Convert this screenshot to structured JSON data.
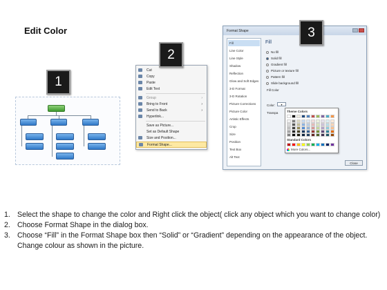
{
  "page": {
    "title": "Edit Color"
  },
  "badges": {
    "one": "1",
    "two": "2",
    "three": "3"
  },
  "context_menu": {
    "items": [
      {
        "label": "Cut",
        "arrow": false
      },
      {
        "label": "Copy",
        "arrow": false
      },
      {
        "label": "Paste",
        "arrow": false
      },
      {
        "label": "Edit Text",
        "arrow": false
      },
      {
        "label": "Group",
        "arrow": true
      },
      {
        "label": "Bring to Front",
        "arrow": true
      },
      {
        "label": "Send to Back",
        "arrow": true
      },
      {
        "label": "Hyperlink...",
        "arrow": false
      },
      {
        "label": "Save as Picture...",
        "arrow": false
      },
      {
        "label": "Set as Default Shape",
        "arrow": false
      },
      {
        "label": "Size and Position...",
        "arrow": false
      },
      {
        "label": "Format Shape...",
        "arrow": false
      }
    ],
    "selected_label": "Format Shape..."
  },
  "dialog": {
    "title": "Format Shape",
    "nav": [
      "Fill",
      "Line Color",
      "Line Style",
      "Shadow",
      "Reflection",
      "Glow and Soft Edges",
      "3-D Format",
      "3-D Rotation",
      "Picture Corrections",
      "Picture Color",
      "Artistic Effects",
      "Crop",
      "Size",
      "Position",
      "Text Box",
      "Alt Text"
    ],
    "selected_nav": "Fill",
    "section_title": "Fill",
    "options": [
      "No fill",
      "Solid fill",
      "Gradient fill",
      "Picture or texture fill",
      "Pattern fill",
      "Slide background fill"
    ],
    "selected_option": "Solid fill",
    "fill_color_label": "Fill Color",
    "color_label": "Color:",
    "transparency_label": "Transpa",
    "palette": {
      "theme_title": "Theme Colors",
      "standard_title": "Standard Colors",
      "more_label": "More Colors...",
      "theme_top": [
        "#ffffff",
        "#000000",
        "#eeece1",
        "#1f497d",
        "#4f81bd",
        "#c0504d",
        "#9bbb59",
        "#8064a2",
        "#4bacc6",
        "#f79646"
      ],
      "theme_shades": [
        [
          "#f2f2f2",
          "#7f7f7f",
          "#ddd9c3",
          "#c6d9f0",
          "#dbe5f1",
          "#f2dcdb",
          "#ebf1dd",
          "#e5e0ec",
          "#dbeef3",
          "#fdeada"
        ],
        [
          "#d8d8d8",
          "#595959",
          "#c4bd97",
          "#8db3e2",
          "#b8cce4",
          "#e5b9b7",
          "#d7e3bc",
          "#ccc1d9",
          "#b7dde8",
          "#fbd5b5"
        ],
        [
          "#bfbfbf",
          "#3f3f3f",
          "#938953",
          "#548dd4",
          "#95b3d7",
          "#d99694",
          "#c3d69b",
          "#b2a2c7",
          "#92cddc",
          "#fac08f"
        ],
        [
          "#a5a5a5",
          "#262626",
          "#494429",
          "#17365d",
          "#366092",
          "#953734",
          "#76923c",
          "#5f497a",
          "#31859b",
          "#e36c09"
        ],
        [
          "#7f7f7f",
          "#0c0c0c",
          "#1d1b10",
          "#0f243e",
          "#244061",
          "#632423",
          "#4f6128",
          "#3f3151",
          "#205867",
          "#974806"
        ]
      ],
      "standard": [
        "#c00000",
        "#ff0000",
        "#ffc000",
        "#ffff00",
        "#92d050",
        "#00b050",
        "#00b0f0",
        "#0070c0",
        "#002060",
        "#7030a0"
      ]
    },
    "close_label": "Close"
  },
  "instructions": [
    {
      "num": "1.",
      "text": "Select the shape to change the color and Right click the object( click any object which you want to change color)"
    },
    {
      "num": "2.",
      "text": "Choose Format Shape in the dialog box."
    },
    {
      "num": "3.",
      "text": "Choose “Fill” in the Format Shape box then “Solid” or “Gradient” depending on the appearance of the object. Change colour as shown in the picture."
    }
  ]
}
